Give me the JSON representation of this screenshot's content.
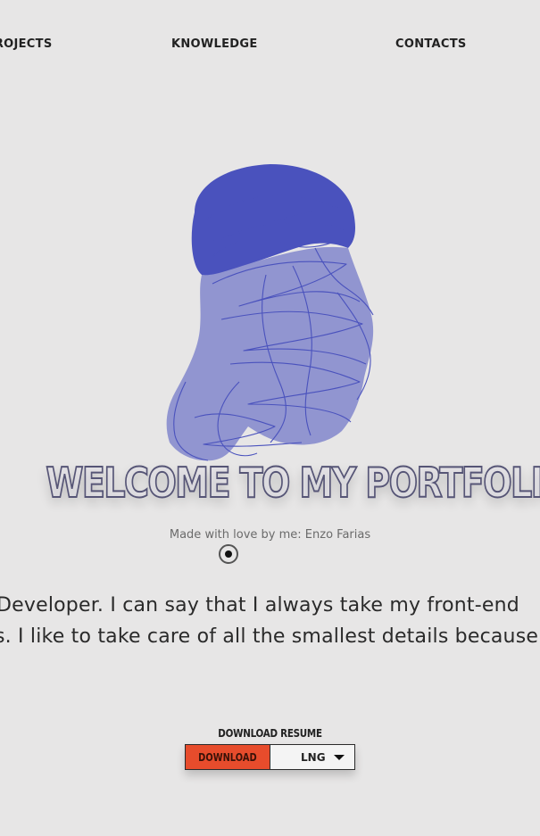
{
  "nav": {
    "projects": "PROJECTS",
    "knowledge": "KNOWLEDGE",
    "contacts": "CONTACTS"
  },
  "hero": {
    "title": "WELCOME TO MY PORTFOLIO",
    "subtitle": "Made with love by me: Enzo Farias",
    "portrait_color": "#4a52bd",
    "scroll_icon": "scroll-down-indicator-icon"
  },
  "intro": {
    "line_1": "Developer. I can say that I always take my front-end",
    "line_2": "s. I like to take care of all the smallest details because"
  },
  "resume": {
    "label": "DOWNLOAD RESUME",
    "download_label": "DOWNLOAD",
    "language_value": "LNG",
    "download_color": "#e74c2c"
  }
}
